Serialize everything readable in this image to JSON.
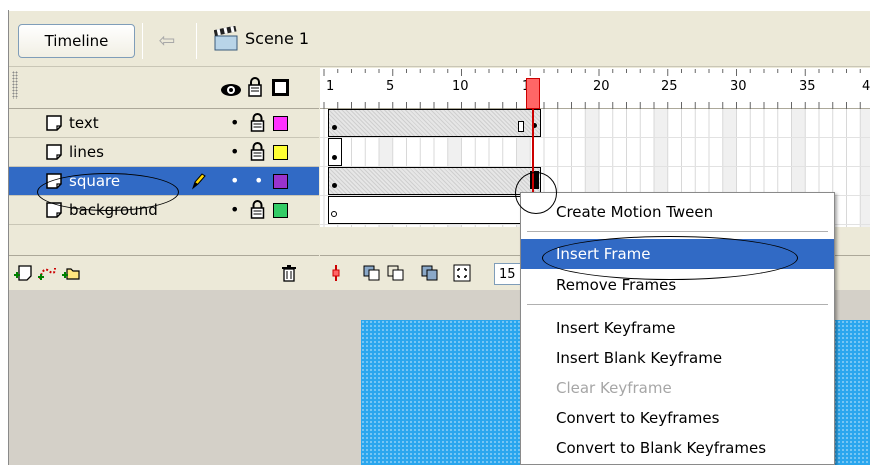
{
  "toolbar": {
    "timeline_label": "Timeline",
    "scene_label": "Scene 1",
    "icons": [
      "back-arrow-icon",
      "scene-clapper-icon"
    ]
  },
  "ruler": {
    "labels": [
      "1",
      "5",
      "10",
      "15",
      "20",
      "25",
      "30",
      "35",
      "4"
    ]
  },
  "layers": [
    {
      "name": "text",
      "color": "#ff33ff",
      "selected": false
    },
    {
      "name": "lines",
      "color": "#ffff33",
      "selected": false
    },
    {
      "name": "square",
      "color": "#9933cc",
      "selected": true
    },
    {
      "name": "background",
      "color": "#33cc66",
      "selected": false
    }
  ],
  "bottom_bar": {
    "frame_number": "15"
  },
  "context_menu": {
    "items": [
      {
        "label": "Create Motion Tween",
        "state": "normal"
      },
      {
        "label": "Insert Frame",
        "state": "highlight"
      },
      {
        "label": "Remove Frames",
        "state": "normal"
      },
      {
        "label": "Insert Keyframe",
        "state": "normal"
      },
      {
        "label": "Insert Blank Keyframe",
        "state": "normal"
      },
      {
        "label": "Clear Keyframe",
        "state": "disabled"
      },
      {
        "label": "Convert to Keyframes",
        "state": "normal"
      },
      {
        "label": "Convert to Blank Keyframes",
        "state": "normal"
      }
    ]
  },
  "colors": {
    "selection": "#316ac5",
    "stage_fill": "#2aa6ee",
    "playhead": "#ff6666"
  }
}
